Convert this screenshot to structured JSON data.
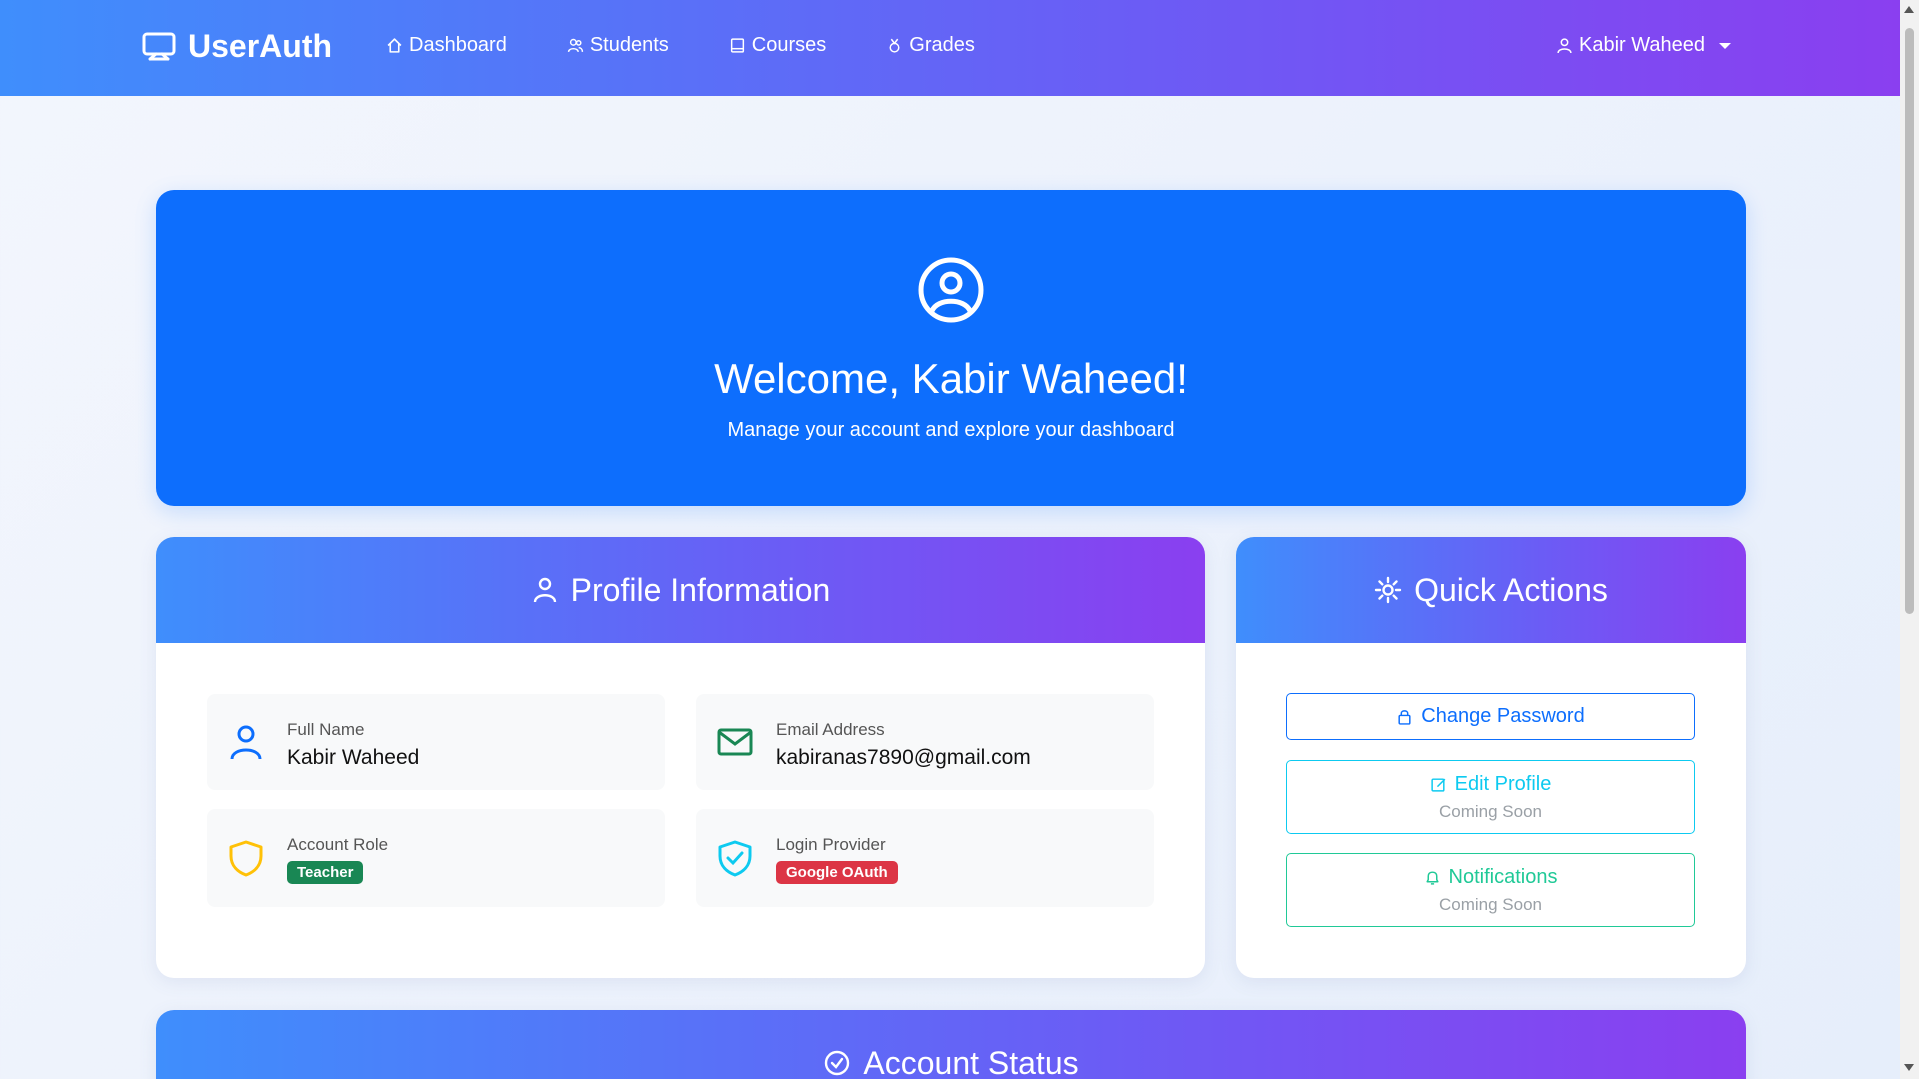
{
  "brand": {
    "name": "UserAuth",
    "icon": "monitor-icon"
  },
  "nav": {
    "items": [
      {
        "label": "Dashboard",
        "icon": "home-icon"
      },
      {
        "label": "Students",
        "icon": "people-icon"
      },
      {
        "label": "Courses",
        "icon": "book-icon"
      },
      {
        "label": "Grades",
        "icon": "medal-icon"
      }
    ],
    "user": {
      "name": "Kabir Waheed",
      "icon": "user-icon"
    }
  },
  "hero": {
    "title": "Welcome, Kabir Waheed!",
    "subtitle": "Manage your account and explore your dashboard"
  },
  "profile": {
    "header": "Profile Information",
    "fields": [
      {
        "label": "Full Name",
        "value": "Kabir Waheed",
        "icon": "user-icon"
      },
      {
        "label": "Email Address",
        "value": "kabiranas7890@gmail.com",
        "icon": "envelope-icon"
      },
      {
        "label": "Account Role",
        "badge": "Teacher",
        "icon": "shield-icon"
      },
      {
        "label": "Login Provider",
        "badge": "Google OAuth",
        "icon": "shield-check-icon"
      }
    ]
  },
  "actions": {
    "header": "Quick Actions",
    "change_password": "Change Password",
    "edit_profile": "Edit Profile",
    "edit_profile_sub": "Coming Soon",
    "notifications": "Notifications",
    "notifications_sub": "Coming Soon"
  },
  "status": {
    "header": "Account Status"
  },
  "colors": {
    "primary": "#0d6efd",
    "gradient_start": "#3f8efc",
    "gradient_end": "#8a3ff0",
    "teacher_badge": "#198754",
    "oauth_badge": "#dc3545",
    "info_cyan": "#0dcaf0",
    "success_green": "#20c997",
    "warning_yellow": "#ffc107"
  }
}
